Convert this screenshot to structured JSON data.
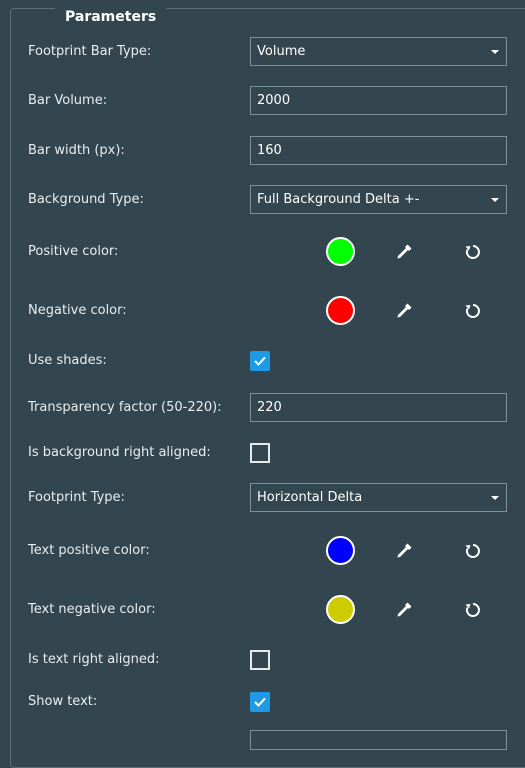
{
  "section_title": "Parameters",
  "colors": {
    "positive": "#00ff00",
    "negative": "#ff0000",
    "text_positive": "#0000ff",
    "text_negative": "#cccc00",
    "checkbox_accent": "#1f9be6"
  },
  "fields": {
    "footprint_bar_type": {
      "label": "Footprint Bar Type:",
      "value": "Volume"
    },
    "bar_volume": {
      "label": "Bar Volume:",
      "value": "2000"
    },
    "bar_width": {
      "label": "Bar width (px):",
      "value": "160"
    },
    "background_type": {
      "label": "Background Type:",
      "value": "Full Background Delta +-"
    },
    "positive_color": {
      "label": "Positive color:"
    },
    "negative_color": {
      "label": "Negative color:"
    },
    "use_shades": {
      "label": "Use shades:",
      "checked": true
    },
    "transparency_factor": {
      "label": "Transparency factor (50-220):",
      "value": "220"
    },
    "bg_right_aligned": {
      "label": "Is background right aligned:",
      "checked": false
    },
    "footprint_type": {
      "label": "Footprint Type:",
      "value": "Horizontal Delta"
    },
    "text_positive_color": {
      "label": "Text positive color:"
    },
    "text_negative_color": {
      "label": "Text negative color:"
    },
    "text_right_aligned": {
      "label": "Is text right aligned:",
      "checked": false
    },
    "show_text": {
      "label": "Show text:",
      "checked": true
    }
  },
  "icons": {
    "picker": "eyedropper-icon",
    "reset": "reset-icon",
    "dropdown": "chevron-down-icon",
    "check": "checkmark-icon"
  }
}
